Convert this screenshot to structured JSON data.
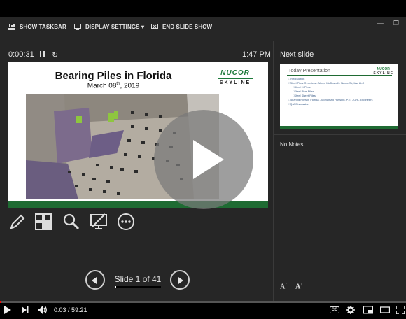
{
  "toolbar": {
    "show_taskbar": "SHOW TASKBAR",
    "display_settings": "DISPLAY SETTINGS ▾",
    "end_slide_show": "END SLIDE SHOW"
  },
  "presenter": {
    "elapsed": "0:00:31",
    "clock": "1:47 PM",
    "slide_counter": "Slide 1 of 41",
    "slide_progress": 0.02439
  },
  "current_slide": {
    "title": "Bearing Piles in Florida",
    "date_day": "March 08",
    "date_suffix": "th",
    "date_year": ", 2019",
    "logo_top": "NUCOR",
    "logo_bottom": "SKYLINE"
  },
  "next_slide": {
    "label": "Next slide",
    "title": "Today Presentation",
    "logo_top": "NUCOR",
    "logo_bottom": "SKYLINE",
    "items": [
      {
        "text": "Introduction",
        "sub": false
      },
      {
        "text": "Steel Piles Overview - Alwyn McDowell - Nucor/Skyline LLC",
        "sub": false
      },
      {
        "text": "Steel H-Piles",
        "sub": true
      },
      {
        "text": "Steel Pipe Piles",
        "sub": true
      },
      {
        "text": "Steel Sheet Piles",
        "sub": true
      },
      {
        "text": "Bearing Piles in Florida - Mohamad Hussein, P.E. - GRL Engineers",
        "sub": false
      },
      {
        "text": "Q-A Discussion",
        "sub": false
      }
    ]
  },
  "notes": {
    "text": "No Notes."
  },
  "video_player": {
    "time": "0:03 / 59:21",
    "progress": 0.00084,
    "cc_label": "CC"
  },
  "colors": {
    "accent_green": "#1f6b33",
    "progress_red": "#ff0000"
  }
}
